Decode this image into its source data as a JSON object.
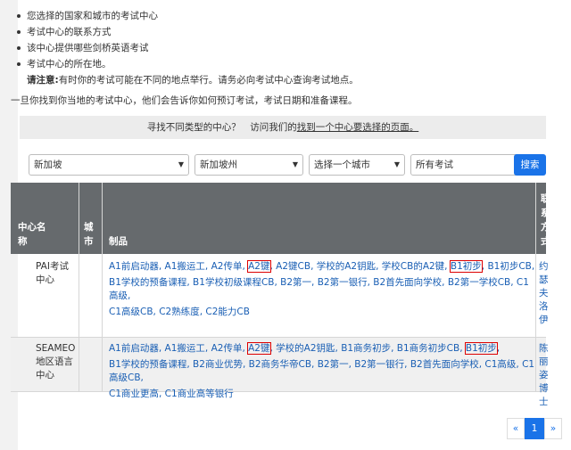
{
  "info_list": [
    "您选择的国家和城市的考试中心",
    "考试中心的联系方式",
    "该中心提供哪些剑桥英语考试",
    "考试中心的所在地。"
  ],
  "note_label": "请注意:",
  "note_text": "有时你的考试可能在不同的地点举行。请务必向考试中心查询考试地点。",
  "intro_text": "一旦你找到你当地的考试中心，他们会告诉你如何预订考试，考试日期和准备课程。",
  "banner": {
    "prefix": "寻找不同类型的中心？　访问我们的",
    "link": "找到一个中心要选择的页面。"
  },
  "filters": {
    "country": "新加坡",
    "region": "新加坡州",
    "city": "选择一个城市",
    "exam": "所有考试",
    "search_label": "搜索"
  },
  "table": {
    "headers": {
      "name": "中心名称",
      "city": "城市",
      "products": "制品",
      "contact": "联系方式"
    },
    "rows": [
      {
        "name": "PAI考试中心",
        "city": "",
        "products_line1_a": "A1前启动器, A1搬运工, A2传单, ",
        "products_line1_hl1": "A2键",
        "products_line1_b": ", A2键CB, 学校的A2钥匙, 学校CB的A2键, ",
        "products_line1_hl2": "B1初步",
        "products_line1_c": ", B1初步CB,",
        "products_line2": "B1学校的预备课程, B1学校初级课程CB, B2第一, B2第一银行, B2首先面向学校, B2第一学校CB, C1高级,",
        "products_line3": "C1高级CB, C2熟练度, C2能力CB",
        "contact": "约瑟夫洛伊"
      },
      {
        "name": "SEAMEO地区语言中心",
        "city": "",
        "products_line1_a": "A1前启动器, A1搬运工, A2传单, ",
        "products_line1_hl1": "A2键",
        "products_line1_b": ", 学校的A2钥匙, B1商务初步, B1商务初步CB, ",
        "products_line1_hl2": "B1初步",
        "products_line1_c": ",",
        "products_line2": "B1学校的预备课程, B2商业优势, B2商务华帝CB, B2第一, B2第一银行, B2首先面向学校, C1高级, C1高级CB,",
        "products_line3": "C1商业更高, C1商业高等银行",
        "contact": "陈丽姿博士"
      }
    ]
  },
  "pagination": {
    "prev": "«",
    "current": "1",
    "next": "»"
  }
}
